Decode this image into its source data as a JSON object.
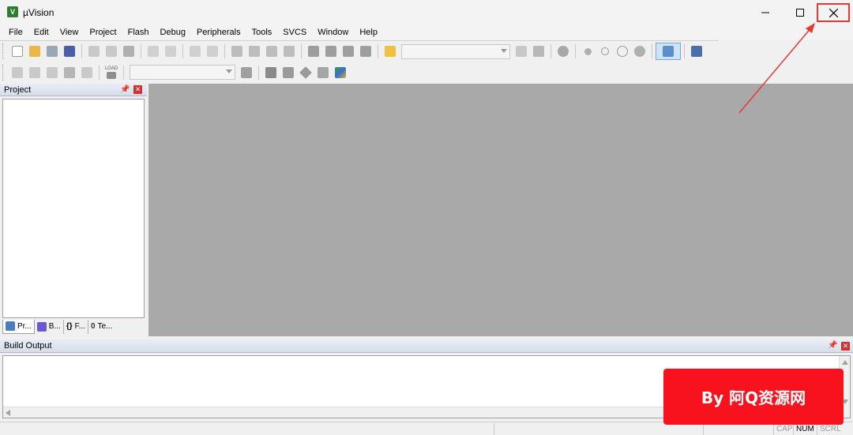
{
  "window": {
    "title": "µVision",
    "app_icon_glyph": "V",
    "controls": {
      "minimize": "minimize-icon",
      "maximize": "maximize-icon",
      "close": "close-icon"
    }
  },
  "menubar": {
    "items": [
      "File",
      "Edit",
      "View",
      "Project",
      "Flash",
      "Debug",
      "Peripherals",
      "Tools",
      "SVCS",
      "Window",
      "Help"
    ]
  },
  "toolbar1": {
    "icons": [
      "new-file-icon",
      "open-folder-icon",
      "save-icon",
      "save-all-icon",
      "cut-icon",
      "copy-icon",
      "paste-icon",
      "undo-icon",
      "redo-icon",
      "navigate-back-icon",
      "navigate-forward-icon",
      "bookmark-icon",
      "bookmark-prev-icon",
      "bookmark-next-icon",
      "bookmark-clear-icon",
      "indent-icon",
      "unindent-icon",
      "comment-icon",
      "uncomment-icon",
      "find-in-files-icon",
      "find-icon",
      "incremental-find-icon",
      "debug-start-icon",
      "breakpoint-insert-icon",
      "breakpoint-disable-icon",
      "breakpoint-disable-all-icon",
      "breakpoint-kill-all-icon",
      "window-layout-icon",
      "configure-icon"
    ],
    "find_combo_value": ""
  },
  "toolbar2": {
    "icons": [
      "translate-icon",
      "build-icon",
      "rebuild-icon",
      "batch-build-icon",
      "stop-build-icon",
      "download-icon",
      "target-options-icon",
      "manage-components-icon",
      "select-packs-icon",
      "pack-installer-icon",
      "event-recorder-icon"
    ],
    "download_label": "LOAD",
    "target_combo_value": ""
  },
  "project_panel": {
    "title": "Project",
    "tabs": [
      {
        "label": "Pr...",
        "icon": "project-tab-icon"
      },
      {
        "label": "B...",
        "icon": "books-tab-icon"
      },
      {
        "label": "F...",
        "icon": "functions-tab-icon",
        "glyph": "{}"
      },
      {
        "label": "Te...",
        "icon": "templates-tab-icon",
        "glyph": "0"
      }
    ]
  },
  "build_output": {
    "title": "Build Output",
    "content": ""
  },
  "statusbar": {
    "cap": "CAP",
    "num": "NUM",
    "scrl": "SCRL"
  },
  "watermark": {
    "text": "By 阿Q资源网"
  },
  "colors": {
    "editor_background": "#a9a9a9",
    "highlight_red": "#e53935",
    "watermark_red": "#f8121d"
  }
}
